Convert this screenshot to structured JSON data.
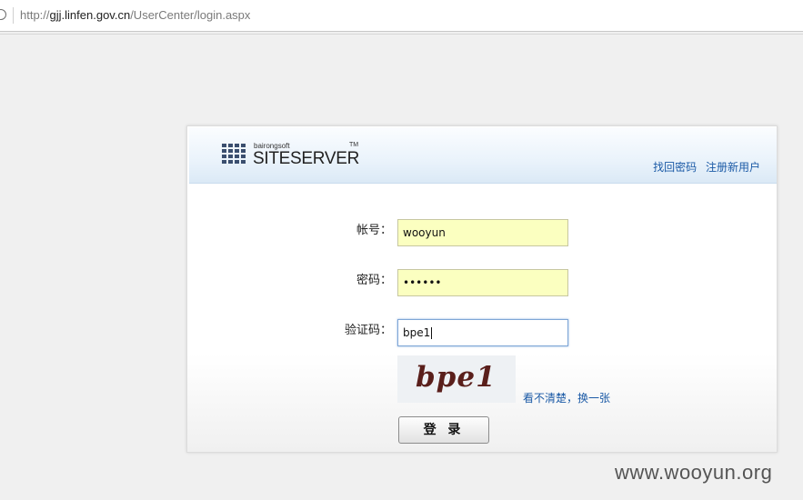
{
  "browser": {
    "url_prefix": "http://",
    "url_host": "gjj.linfen.gov.cn",
    "url_path": "/UserCenter/login.aspx"
  },
  "logo": {
    "company": "bairongsoft",
    "product": "SITESERVER",
    "trademark": "TM"
  },
  "header_links": {
    "forgot_password": "找回密码",
    "register": "注册新用户"
  },
  "form": {
    "account_label": "帐号：",
    "account_value": "wooyun",
    "password_label": "密码：",
    "password_value": "••••••",
    "captcha_label": "验证码：",
    "captcha_value": "bpe1",
    "captcha_image_text": "bpe1",
    "refresh_captcha": "看不清楚，换一张",
    "login_button": "登 录"
  },
  "watermark": "www.wooyun.org"
}
